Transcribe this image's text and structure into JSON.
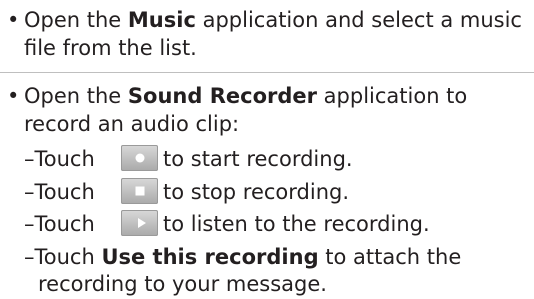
{
  "bullet_symbol": "•",
  "dash_symbol": "–",
  "item1": {
    "pre": "Open the ",
    "bold": "Music",
    "post_line1": " application and select a music",
    "line2": "file from the list."
  },
  "item2": {
    "pre": "Open the ",
    "bold": "Sound Recorder",
    "post_line1": " application to",
    "line2": "record an audio clip:"
  },
  "sub_items": [
    {
      "pre": "Touch ",
      "icon": "record-icon",
      "post": " to start recording."
    },
    {
      "pre": "Touch ",
      "icon": "stop-icon",
      "post": " to stop recording."
    },
    {
      "pre": "Touch ",
      "icon": "play-icon",
      "post": " to listen to the recording."
    }
  ],
  "sub_last": {
    "pre": "Touch ",
    "bold": "Use this recording",
    "post_line1": " to attach the",
    "line2": "recording to your message."
  },
  "colors": {
    "text": "#231f20",
    "divider": "#bfbfbf",
    "icon_bg": "#b8b8b8"
  }
}
